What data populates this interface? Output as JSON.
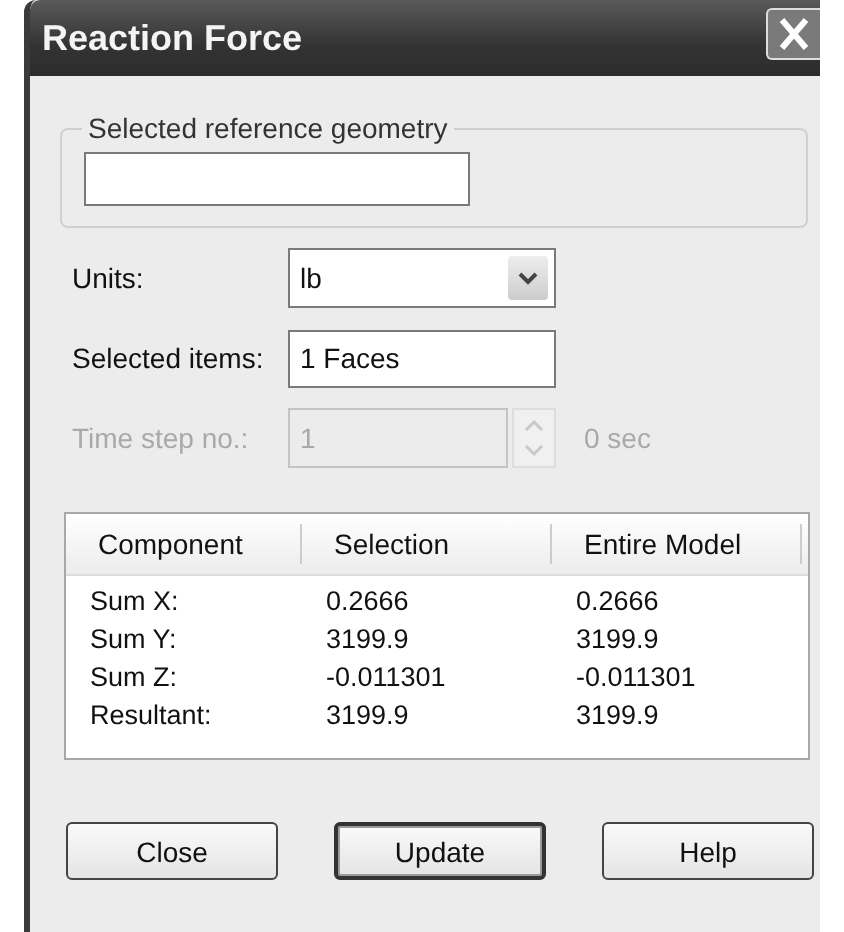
{
  "window": {
    "title": "Reaction Force"
  },
  "reference_group": {
    "label": "Selected reference geometry"
  },
  "units": {
    "label": "Units:",
    "value": "lb"
  },
  "selected_items": {
    "label": "Selected items:",
    "value": "1 Faces"
  },
  "time_step": {
    "label": "Time step no.:",
    "value": "1",
    "reading": "0 sec",
    "disabled": true
  },
  "table": {
    "columns": [
      "Component",
      "Selection",
      "Entire Model"
    ],
    "rows": [
      [
        "Sum X:",
        "0.2666",
        "0.2666"
      ],
      [
        "Sum Y:",
        "3199.9",
        "3199.9"
      ],
      [
        "Sum Z:",
        "-0.011301",
        "-0.011301"
      ],
      [
        "Resultant:",
        "3199.9",
        "3199.9"
      ]
    ]
  },
  "buttons": [
    {
      "label": "Close",
      "default": false
    },
    {
      "label": "Update",
      "default": true
    },
    {
      "label": "Help",
      "default": false
    }
  ]
}
